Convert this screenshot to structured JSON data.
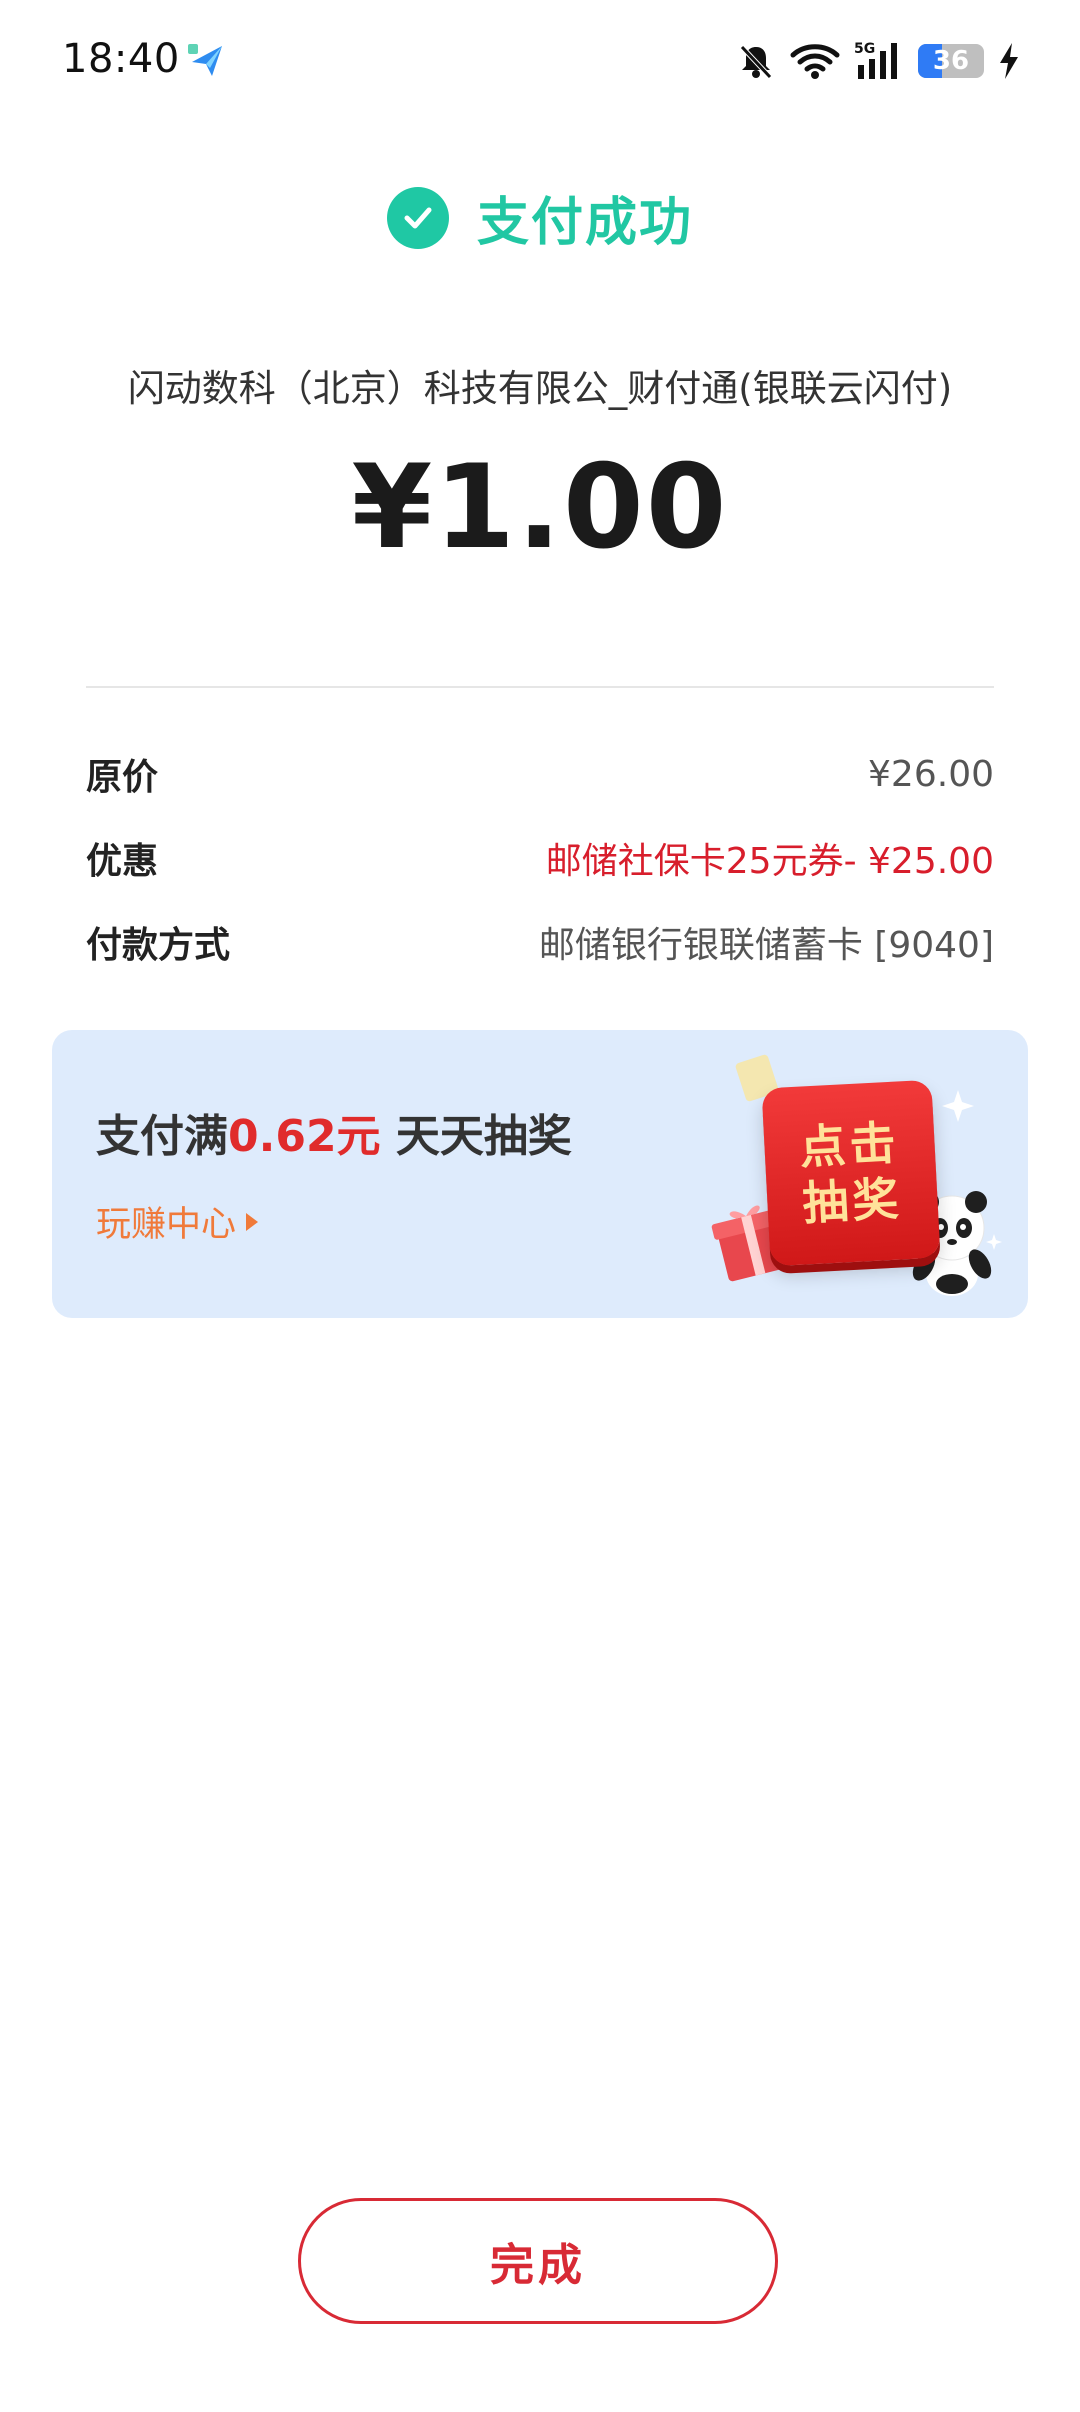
{
  "status_bar": {
    "time": "18:40",
    "battery": "36",
    "battery_level": 0.36,
    "network": "5G",
    "icons": [
      "app-notification-icon",
      "mute-bell-icon",
      "wifi-icon",
      "signal-5g-icon",
      "battery-icon",
      "charging-bolt-icon"
    ]
  },
  "header": {
    "title": "支付成功",
    "icon": "check-circle-icon",
    "accent_color": "#21c7a3"
  },
  "payment": {
    "merchant": "闪动数科（北京）科技有限公_财付通(银联云闪付)",
    "amount": "¥1.00"
  },
  "details": [
    {
      "label": "原价",
      "value": "¥26.00"
    },
    {
      "label": "优惠",
      "value": "邮储社保卡25元券- ¥25.00"
    },
    {
      "label": "付款方式",
      "value": "邮储银行银联储蓄卡 [9040]"
    }
  ],
  "promo": {
    "title_prefix": "支付满",
    "title_highlight": "0.62元",
    "title_suffix": " 天天抽奖",
    "link_label": "玩赚中心",
    "lottery_line1": "点击",
    "lottery_line2": "抽奖",
    "highlight_color": "#e02b2b",
    "background_color": "#deebfc"
  },
  "footer": {
    "done_label": "完成",
    "done_color": "#d82a35"
  }
}
